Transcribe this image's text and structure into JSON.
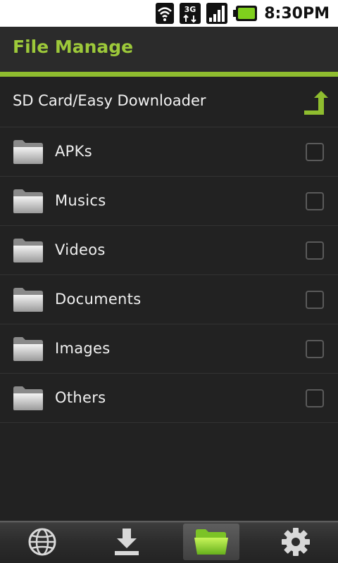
{
  "status_bar": {
    "clock": "8:30PM",
    "network_label": "3G",
    "icons": [
      "wifi-icon",
      "3g-data-icon",
      "signal-icon",
      "battery-icon"
    ]
  },
  "header": {
    "title": "File Manage"
  },
  "path_bar": {
    "path": "SD Card/Easy Downloader",
    "up_icon": "folder-up-icon"
  },
  "folders": [
    {
      "label": "APKs",
      "checked": false
    },
    {
      "label": "Musics",
      "checked": false
    },
    {
      "label": "Videos",
      "checked": false
    },
    {
      "label": "Documents",
      "checked": false
    },
    {
      "label": "Images",
      "checked": false
    },
    {
      "label": "Others",
      "checked": false
    }
  ],
  "bottom_nav": {
    "items": [
      {
        "icon": "globe-icon",
        "active": false
      },
      {
        "icon": "download-icon",
        "active": false
      },
      {
        "icon": "folder-icon",
        "active": true
      },
      {
        "icon": "gear-icon",
        "active": false
      }
    ]
  },
  "colors": {
    "accent": "#8fbd2f",
    "title": "#9dc93a",
    "background": "#222222"
  }
}
